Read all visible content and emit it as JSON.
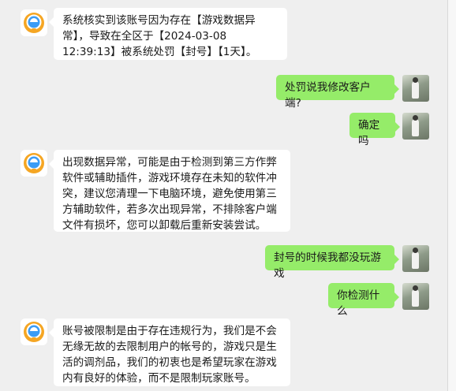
{
  "messages": [
    {
      "sender": "bot",
      "text": "系统核实到该账号因为存在【游戏数据异常】，导致在全区于【2024-03-08 12:39:13】被系统处罚【封号】【1天】。"
    },
    {
      "sender": "user",
      "text": "处罚说我修改客户端?"
    },
    {
      "sender": "user",
      "text": "确定吗"
    },
    {
      "sender": "bot",
      "text": "出现数据异常，可能是由于检测到第三方作弊软件或辅助插件，游戏环境存在未知的软件冲突，建议您清理一下电脑环境，避免使用第三方辅助软件，若多次出现异常，不排除客户端文件有损坏，您可以卸载后重新安装尝试。"
    },
    {
      "sender": "user",
      "text": "封号的时候我都没玩游戏"
    },
    {
      "sender": "user",
      "text": "你检测什么"
    },
    {
      "sender": "bot",
      "text": "账号被限制是由于存在违规行为，我们是不会无缘无故的去限制用户的帐号的，游戏只是生活的调剂品，我们的初衷也是希望玩家在游戏内有良好的体验，而不是限制玩家账号。"
    }
  ],
  "colors": {
    "background": "#efefef",
    "incoming_bubble": "#ffffff",
    "outgoing_bubble": "#95ec69",
    "bot_avatar_ring": "#f5a623",
    "bot_avatar_inner": "#3b9cf5"
  },
  "icons": {
    "bot_avatar": "support-bot-avatar-icon",
    "user_avatar": "user-photo-avatar"
  }
}
